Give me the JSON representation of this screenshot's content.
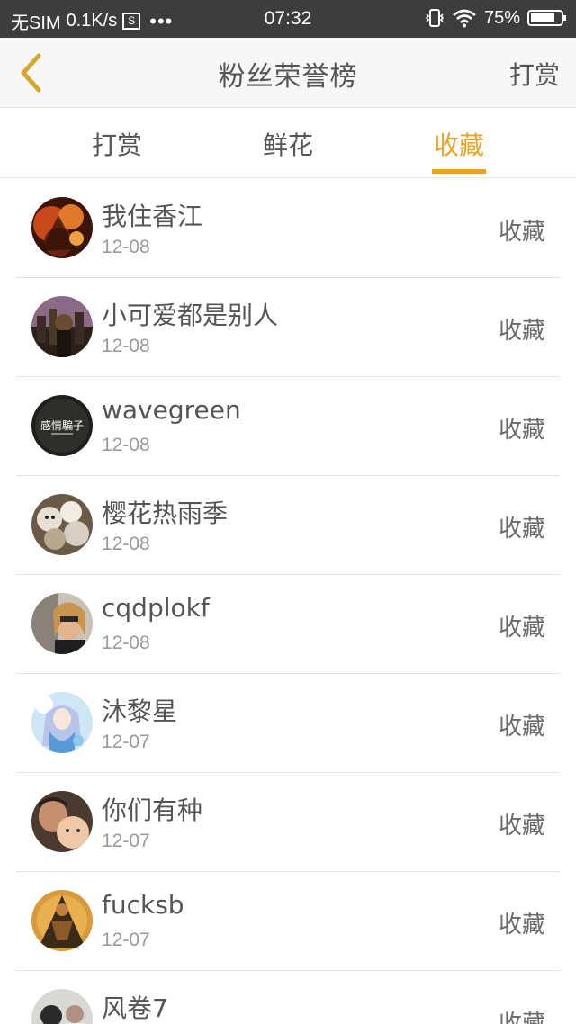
{
  "status_bar": {
    "carrier": "无SIM",
    "speed": "0.1K/s",
    "sim_icon": "S",
    "dots": "•••",
    "time": "07:32",
    "battery": "75%",
    "icons": [
      "sim-card-icon",
      "vibrate-icon",
      "wifi-icon",
      "battery-icon"
    ]
  },
  "header": {
    "back_icon": "chevron-left-icon",
    "back_color": "#d4a82c",
    "title": "粉丝荣誉榜",
    "action": "打赏"
  },
  "tabs": [
    {
      "label": "打赏",
      "active": false
    },
    {
      "label": "鲜花",
      "active": false
    },
    {
      "label": "收藏",
      "active": true
    }
  ],
  "accent_color": "#f0a020",
  "fans": [
    {
      "name": "我住香江",
      "date": "12-08",
      "type": "收藏",
      "avatar": "fire-warrior-avatar"
    },
    {
      "name": "小可爱都是别人",
      "date": "12-08",
      "type": "收藏",
      "avatar": "city-sunset-avatar"
    },
    {
      "name": "wavegreen",
      "date": "12-08",
      "type": "收藏",
      "avatar": "text-logo-avatar",
      "avatar_text": "感情騙子"
    },
    {
      "name": "樱花热雨季",
      "date": "12-08",
      "type": "收藏",
      "avatar": "plush-toys-avatar"
    },
    {
      "name": "cqdplokf",
      "date": "12-08",
      "type": "收藏",
      "avatar": "woman-selfie-avatar"
    },
    {
      "name": "沐黎星",
      "date": "12-07",
      "type": "收藏",
      "avatar": "anime-girl-avatar"
    },
    {
      "name": "你们有种",
      "date": "12-07",
      "type": "收藏",
      "avatar": "father-baby-avatar"
    },
    {
      "name": "fucksb",
      "date": "12-07",
      "type": "收藏",
      "avatar": "golden-warrior-avatar"
    },
    {
      "name": "风卷7",
      "date": "",
      "type": "收藏",
      "avatar": "people-photo-avatar"
    }
  ]
}
